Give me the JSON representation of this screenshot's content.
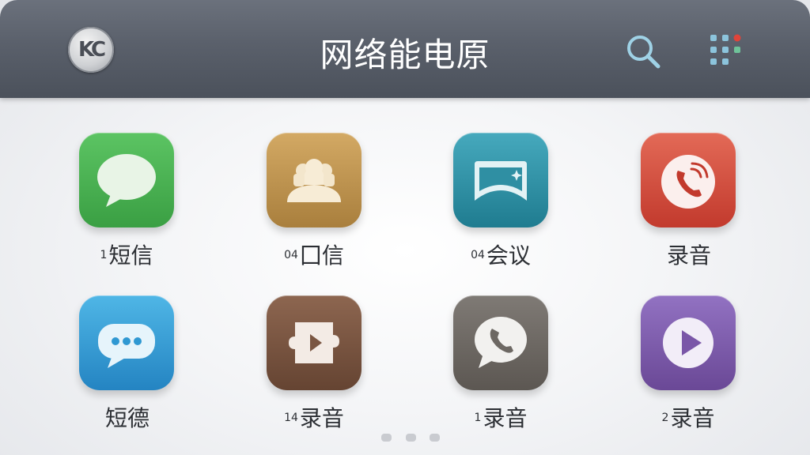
{
  "header": {
    "logo_text": "KC",
    "title": "网络能电原",
    "search_icon": "search-icon",
    "menu_icon": "apps-grid-icon"
  },
  "apps": [
    {
      "prefix": "1",
      "label": "短信",
      "icon": "chat-bubble-icon",
      "color": "#3fa648"
    },
    {
      "prefix": "04",
      "label": "囗信",
      "icon": "group-meeting-icon",
      "color": "#b9904c"
    },
    {
      "prefix": "04",
      "label": "会议",
      "icon": "conference-screen-icon",
      "color": "#2f8fa3"
    },
    {
      "prefix": "",
      "label": "录音",
      "icon": "phone-ringing-icon",
      "color": "#d24a3c"
    },
    {
      "prefix": "",
      "label": "短德",
      "icon": "message-dots-icon",
      "color": "#2f98d2"
    },
    {
      "prefix": "14",
      "label": "录音",
      "icon": "video-clip-icon",
      "color": "#7a5642"
    },
    {
      "prefix": "1",
      "label": "录音",
      "icon": "phone-chat-icon",
      "color": "#6d6863"
    },
    {
      "prefix": "2",
      "label": "录音",
      "icon": "play-icon",
      "color": "#7a56a8"
    }
  ],
  "pager": {
    "pages": 3
  }
}
